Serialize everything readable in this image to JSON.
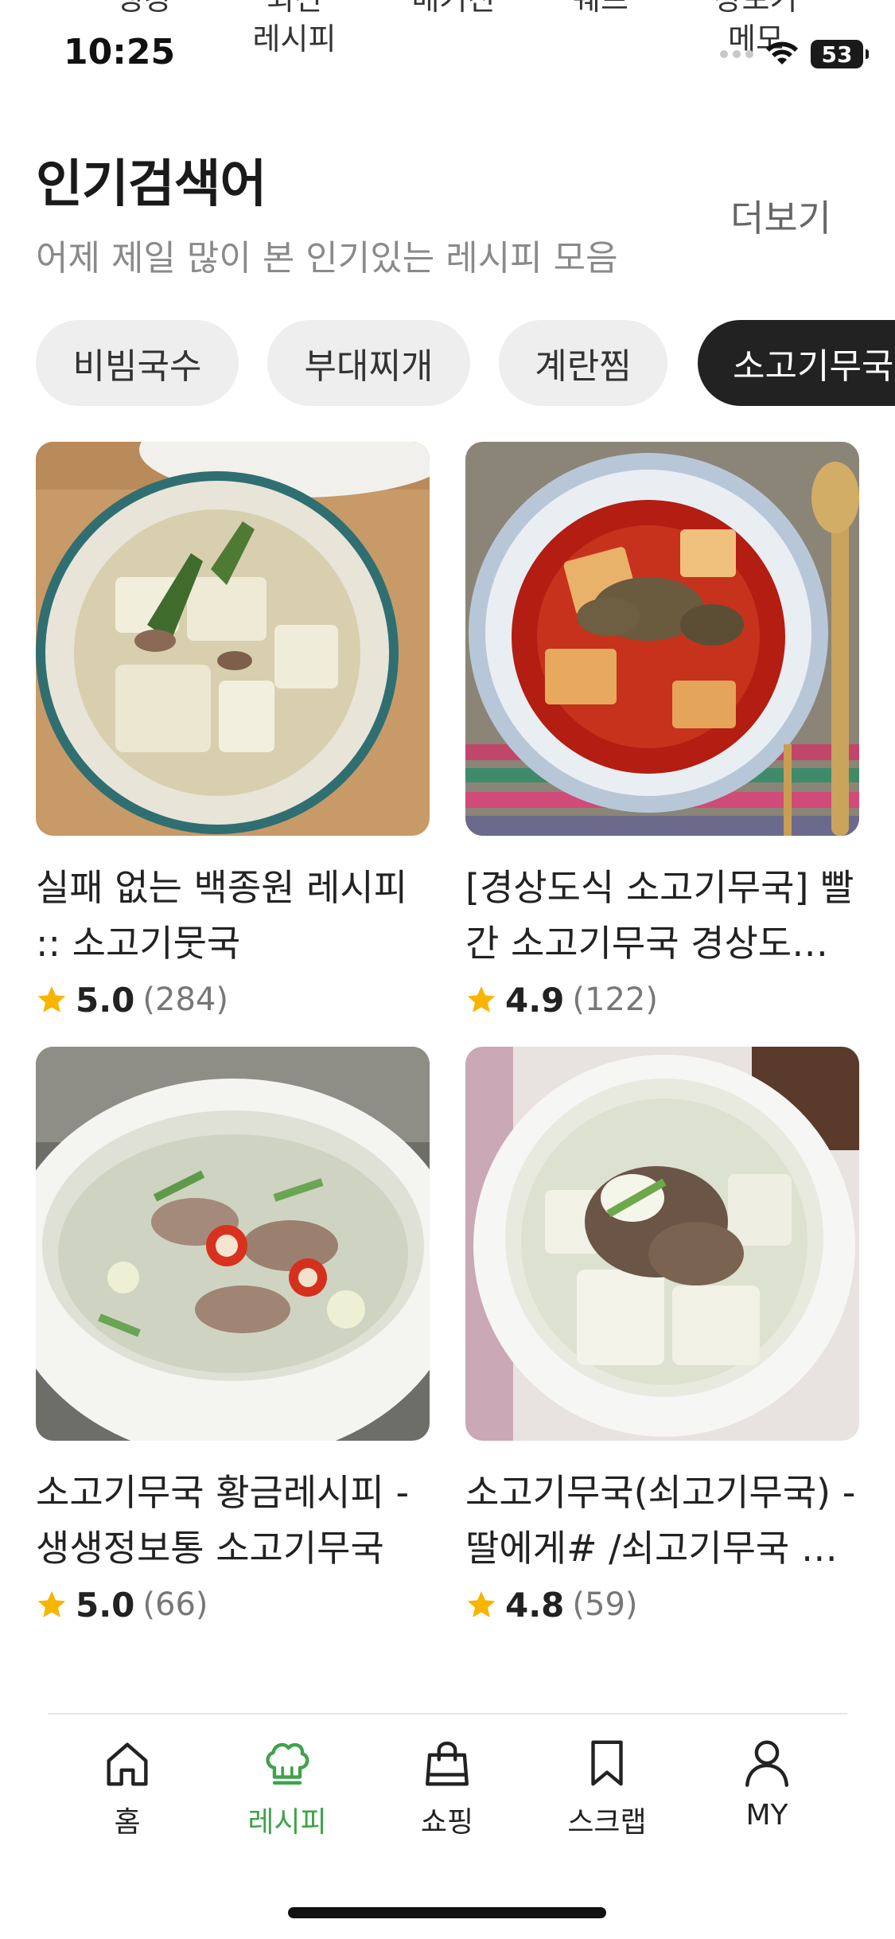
{
  "top_tabs": [
    "랭킹",
    "최신\n레시피",
    "매거진",
    "쉐프",
    "장보기\n메모"
  ],
  "status_bar": {
    "time": "10:25",
    "battery": "53"
  },
  "section": {
    "title": "인기검색어",
    "subtitle": "어제 제일 많이 본 인기있는 레시피 모음",
    "more": "더보기"
  },
  "chips": [
    "비빔국수",
    "부대찌개",
    "계란찜",
    "소고기무국"
  ],
  "active_chip_index": 3,
  "recipes": [
    {
      "title": "실패 없는 백종원 레시피 :: 소고기뭇국",
      "rating": "5.0",
      "count": "(284)"
    },
    {
      "title": "[경상도식 소고기무국] 빨간 소고기무국 경상도식 소고기국",
      "rating": "4.9",
      "count": "(122)"
    },
    {
      "title": "소고기무국 황금레시피 - 생생정보통 소고기무국",
      "rating": "5.0",
      "count": "(66)"
    },
    {
      "title": " 소고기무국(쇠고기무국) - 딸에게# /쇠고기무국 끓이는법",
      "rating": "4.8",
      "count": "(59)"
    }
  ],
  "tab_bar": {
    "items": [
      {
        "label": "홈",
        "icon": "home-icon"
      },
      {
        "label": "레시피",
        "icon": "chef-hat-icon"
      },
      {
        "label": "쇼핑",
        "icon": "shopping-bag-icon"
      },
      {
        "label": "스크랩",
        "icon": "bookmark-icon"
      },
      {
        "label": "MY",
        "icon": "person-icon"
      }
    ],
    "active_index": 1,
    "active_color": "#3ea34a"
  },
  "colors": {
    "accent": "#3ea34a",
    "star": "#f7b500",
    "chip_active_bg": "#222222",
    "chip_bg": "#eeeeee"
  }
}
